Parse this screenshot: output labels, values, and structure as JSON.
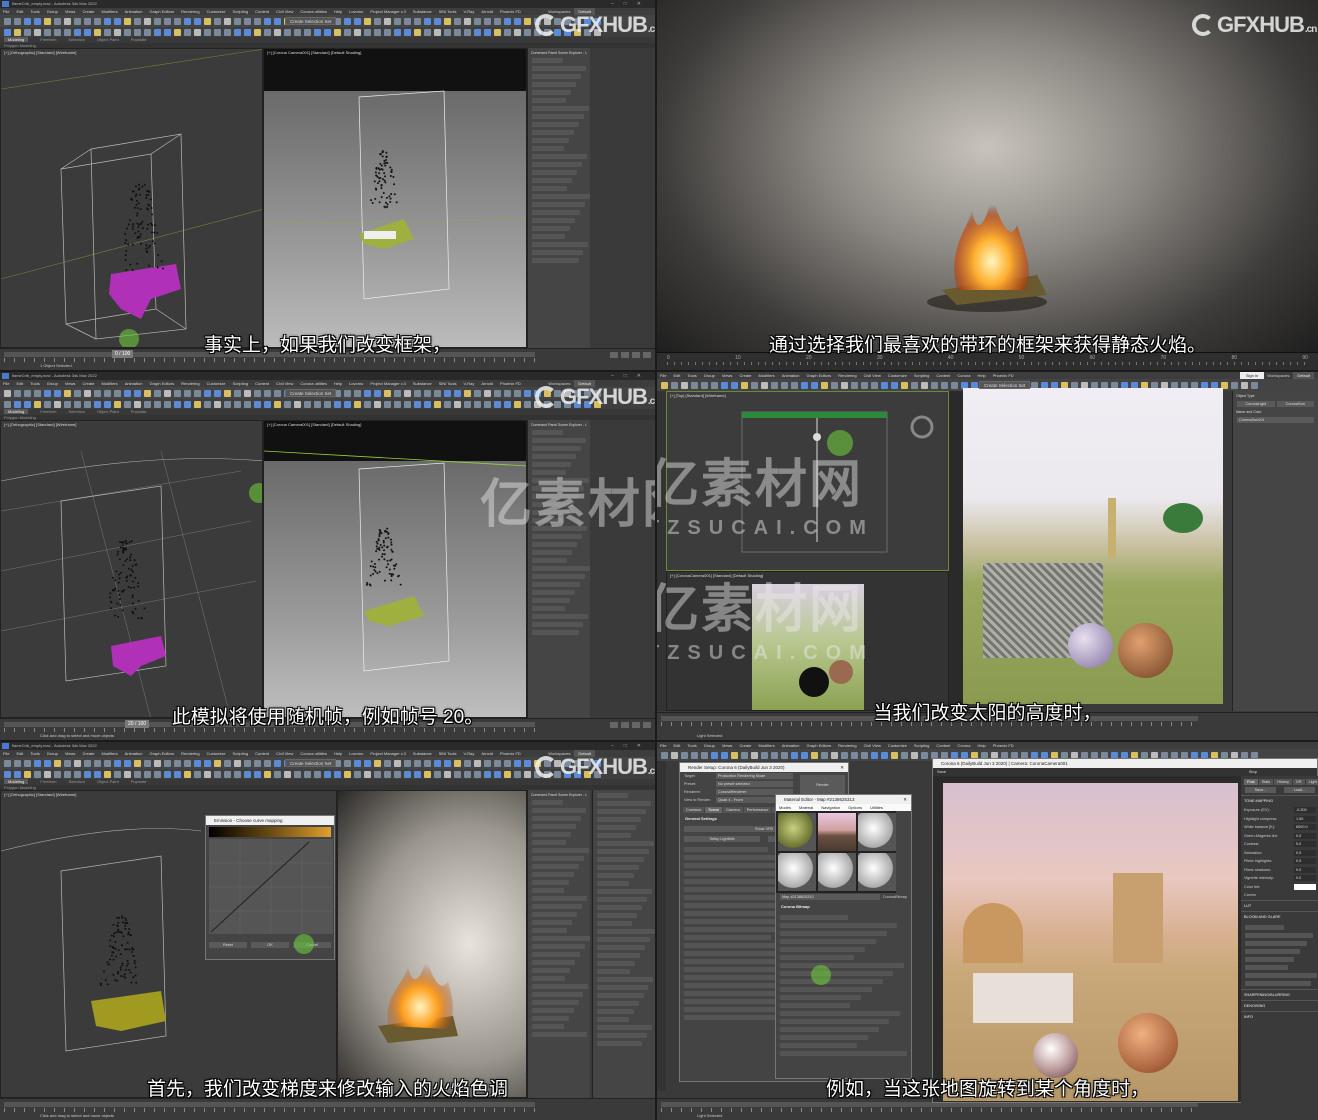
{
  "app": {
    "title": "flameCrib_empty.max - Autodesk 3ds Max 2022",
    "menu": [
      "File",
      "Edit",
      "Tools",
      "Group",
      "Views",
      "Create",
      "Modifiers",
      "Animation",
      "Graph Editors",
      "Rendering",
      "Customize",
      "Scripting",
      "Content",
      "Civil View",
      "Corona utilities",
      "Help",
      "Lovomo",
      "Project Manager v.3",
      "Substance",
      "SiNi Tools",
      "V-Ray",
      "Arnold",
      "Phoenix FD"
    ],
    "menu_short": [
      "File",
      "Edit",
      "Tools",
      "Group",
      "Views",
      "Create",
      "Modifiers",
      "Animation",
      "Graph Editors",
      "Rendering",
      "Civil View",
      "Customize",
      "Scripting",
      "Content",
      "Corona",
      "Help",
      "Phoenix FD"
    ],
    "ribbon_tabs": [
      "Modeling",
      "Freeform",
      "Selection",
      "Object Paint",
      "Populate"
    ],
    "ribbon_sub": "Polygon Modeling",
    "selection_set": "Create Selection Set",
    "workspace_label": "Workspaces:",
    "workspace_value": "Default",
    "sign_in": "Sign In",
    "vp_ortho": "[+] [Orthographic] [Standard] [Wireframe]",
    "vp_camera": "[+] [Corona Camera001] [Standard] [Default Shading]",
    "vp_top": "[+] [Top] [Standard] [Wireframe]",
    "vp_corona_cam": "[+] [CoronaCamera001] [Standard] [Default Shading]",
    "cmd_tabs": "Command Panel   Scene Explorer - Layer Explorer 1",
    "status_selected": "1 Object Selected",
    "status_hint": "Click and drag to select and move objects",
    "status_light": "Light Selected",
    "frame_counter": "0 / 100",
    "frame_counter_b": "20 / 100"
  },
  "brand": {
    "gfxhub": "GFXHUB",
    "gfxhub_tld": ".cn",
    "watermark": "亿素材网",
    "watermark_url": "TZSUCAI.COM"
  },
  "subtitles": {
    "a": "事实上，如果我们改变框架，",
    "b": "通过选择我们最喜欢的带环的框架来获得静态火焰。",
    "c": "此模拟将使用随机帧，例如帧号 20。",
    "d": "当我们改变太阳的高度时，",
    "e": "首先，我们改变梯度来修改输入的火焰色调",
    "f": "例如，当这张地图旋转到某个角度时，"
  },
  "timeline_b": [
    "0",
    "10",
    "20",
    "30",
    "40",
    "50",
    "60",
    "70",
    "80",
    "90"
  ],
  "command_panel": {
    "object_type": "Object Type",
    "name_and_color": "Name and Color",
    "object_name": "CoronaSun001",
    "buttons": [
      "CoronaLight",
      "CoronaSun"
    ]
  },
  "curve_dialog": {
    "title": "Emission - Choose curve mapping",
    "buttons": [
      "Reset",
      "OK",
      "Cancel"
    ]
  },
  "render_setup": {
    "title": "Render Setup: Corona 6 (DailyBuild Jun 3 2020)",
    "target_label": "Target:",
    "target": "Production Rendering Mode",
    "preset_label": "Preset:",
    "preset": "No preset selected",
    "renderer_label": "Renderer:",
    "renderer": "CoronaRenderer",
    "view_label": "View to Render:",
    "view": "Quad 4 - Front",
    "render_button": "Render",
    "tabs": [
      "Common",
      "Scene",
      "Camera",
      "Performance",
      "Sys"
    ],
    "section": "General Settings",
    "show_vfb": "Show VFB",
    "setup_lightmix": "Setup LightMix",
    "open_material": "Open Material Li..."
  },
  "material_editor": {
    "title": "Material Editor - Map #2138625313",
    "menu": [
      "Modes",
      "Material",
      "Navigation",
      "Options",
      "Utilities"
    ],
    "map_name": "Map #2138625313",
    "map_type": "CoronaBitmap",
    "section": "Corona Bitmap"
  },
  "vfb": {
    "title": "Corona 6 (DailyBuild Jun 3 2020) | Camera: CoronaCamera001",
    "save": "Save",
    "stop": "Stop",
    "tabs": [
      "Post",
      "Stats",
      "History",
      "DR",
      "Light"
    ],
    "save_btn": "Save...",
    "load_btn": "Load...",
    "tone_mapping": "TONE MAPPING",
    "params": [
      {
        "label": "Exposure (EV):",
        "value": "-0.300"
      },
      {
        "label": "Highlight compress:",
        "value": "1.50"
      },
      {
        "label": "White balance [K]:",
        "value": "6500.0"
      },
      {
        "label": "Green-Magenta tint:",
        "value": "0.0"
      },
      {
        "label": "Contrast:",
        "value": "5.0"
      },
      {
        "label": "Saturation:",
        "value": "0.0"
      },
      {
        "label": "Filmic highlights:",
        "value": "0.0"
      },
      {
        "label": "Filmic shadows:",
        "value": "0.0"
      },
      {
        "label": "Vignette intensity:",
        "value": "0.0"
      }
    ],
    "color_tint": "Color tint:",
    "curves": "Curves",
    "lut": "LUT",
    "bloom": "BLOOM AND GLARE",
    "sharpen": "SHARPENING/BLURRING",
    "denoise": "DENOISING",
    "info": "INFO"
  },
  "colors": {
    "accent": "#5a8ad8",
    "magenta": "#c030c0",
    "cursor": "#6ec83c"
  }
}
